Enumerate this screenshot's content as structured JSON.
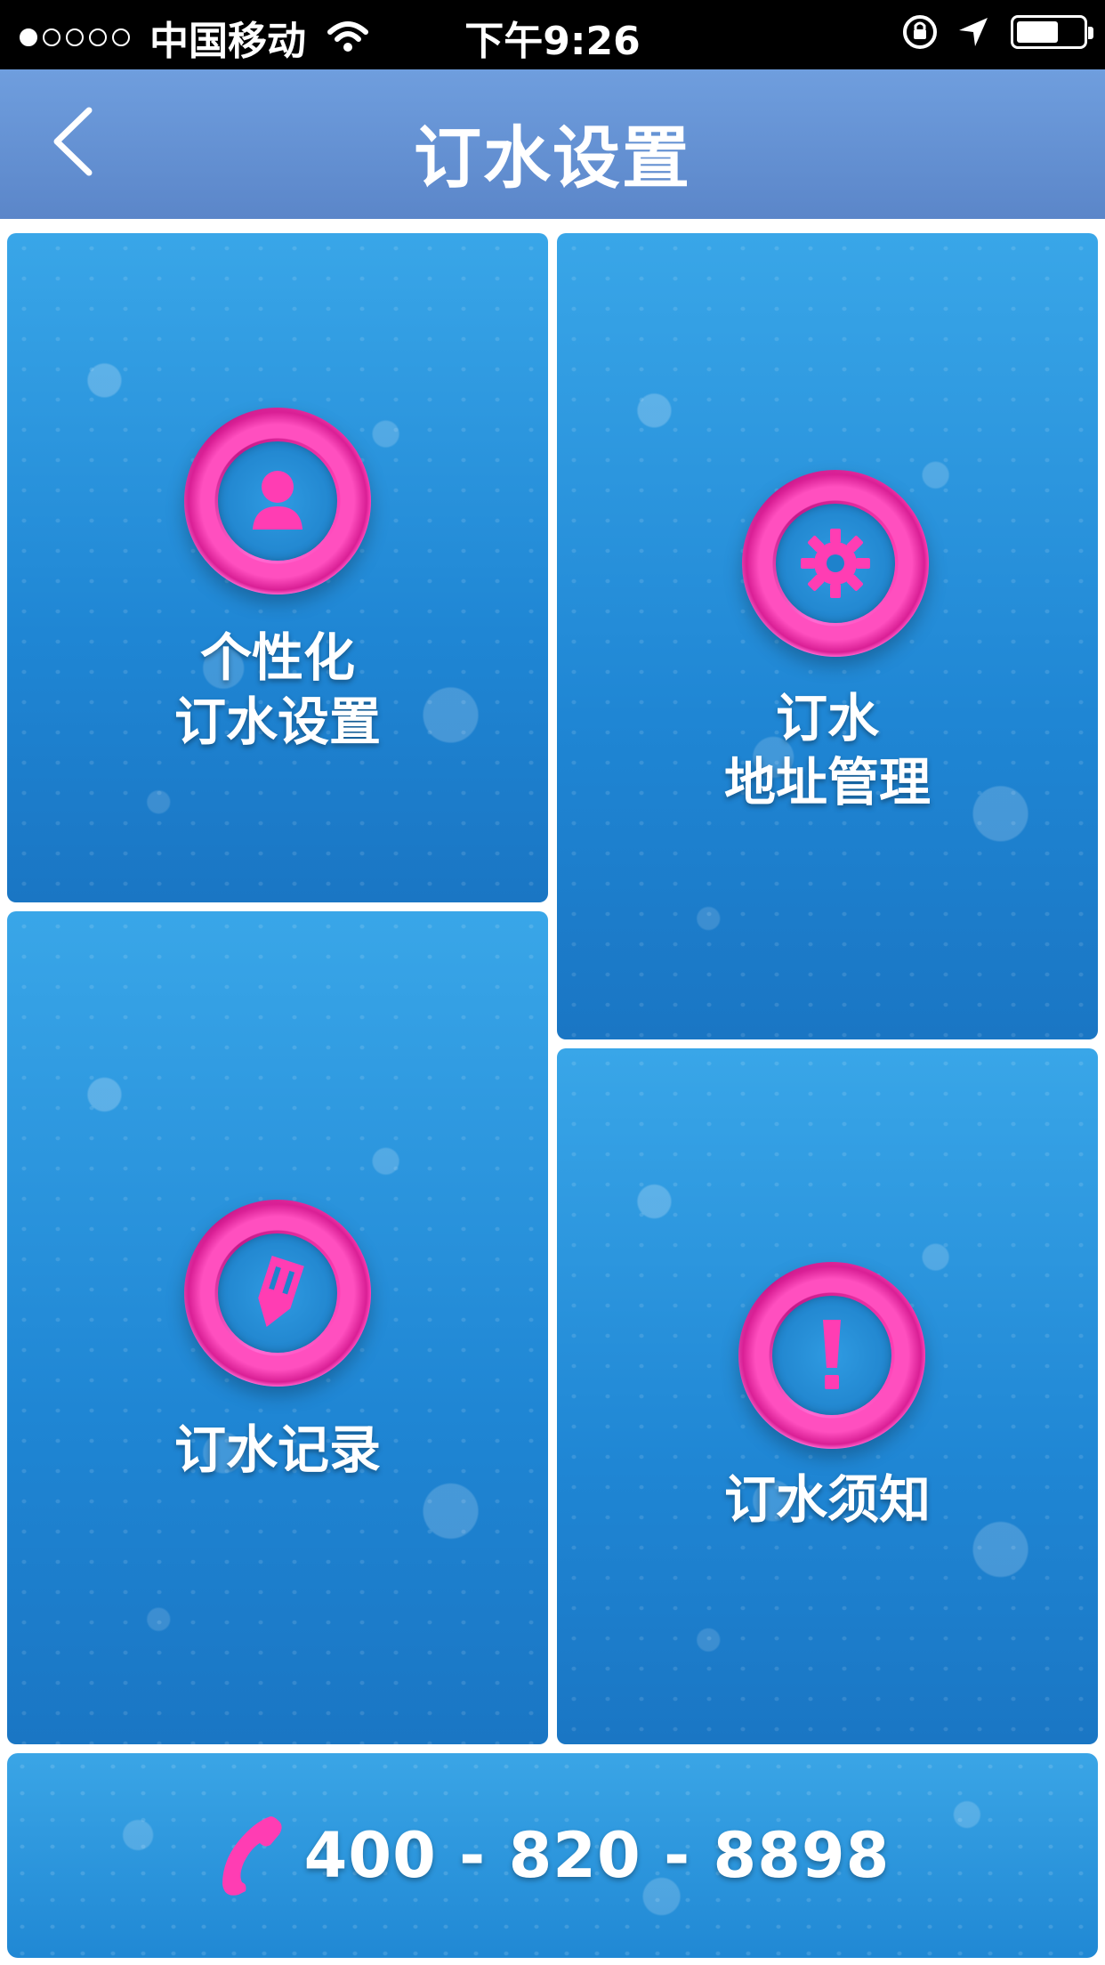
{
  "status_bar": {
    "carrier": "中国移动",
    "time": "下午9:26",
    "signal_dots_filled": 1,
    "signal_dots_total": 5,
    "battery_level": 0.55
  },
  "navbar": {
    "title": "订水设置",
    "back_icon": "chevron-left-icon"
  },
  "tiles": [
    {
      "line1": "个性化",
      "line2": "订水设置",
      "icon": "person-icon"
    },
    {
      "line1": "订水",
      "line2": "地址管理",
      "icon": "gear-icon"
    },
    {
      "line1": "订水记录",
      "icon": "pencil-icon"
    },
    {
      "line1": "订水须知",
      "icon": "exclamation-icon"
    }
  ],
  "phone": {
    "number": "400 - 820 - 8898",
    "icon": "phone-icon"
  },
  "colors": {
    "navbar": "#6a97d8",
    "tile_blue": "#2a93dc",
    "accent_pink": "#ff3db3"
  }
}
